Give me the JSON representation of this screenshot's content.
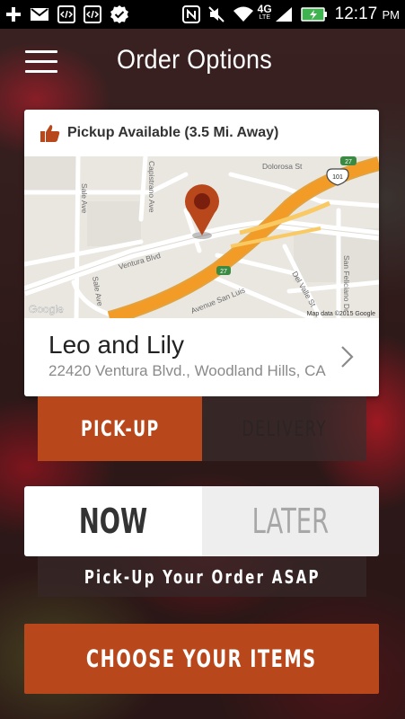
{
  "status_bar": {
    "time": "12:17",
    "ampm": "PM",
    "network_label": "4G",
    "network_sub": "LTE",
    "icons": [
      "add-icon",
      "gmail-icon",
      "code-icon",
      "code-icon",
      "checkmark-icon",
      "nfc-icon",
      "mute-icon",
      "wifi-icon",
      "signal-icon",
      "battery-charging-icon"
    ]
  },
  "header": {
    "title": "Order Options"
  },
  "store_card": {
    "availability_text": "Pickup Available (3.5 Mi. Away)",
    "store_name": "Leo and Lily",
    "store_address": "22420 Ventura Blvd., Woodland Hills, CA",
    "map": {
      "streets": [
        "Dolorosa St",
        "Capistrano Ave",
        "Sale Ave",
        "Ventura Blvd",
        "Sale Ave",
        "Avenue San Luis",
        "Del Valle St",
        "San Feliciano Dr"
      ],
      "highway_shields": [
        "101",
        "27",
        "27"
      ],
      "google_label": "Google",
      "attribution": "Map data ©2015 Google"
    }
  },
  "order_mode": {
    "options": [
      "PICK-UP",
      "DELIVERY"
    ],
    "selected": "PICK-UP"
  },
  "order_time": {
    "options": [
      "NOW",
      "LATER"
    ],
    "selected": "NOW",
    "helper_text": "Pick-Up Your Order ASAP"
  },
  "cta": {
    "label": "CHOOSE YOUR ITEMS"
  },
  "colors": {
    "accent": "#b8481c",
    "map_highway": "#f29b27"
  }
}
